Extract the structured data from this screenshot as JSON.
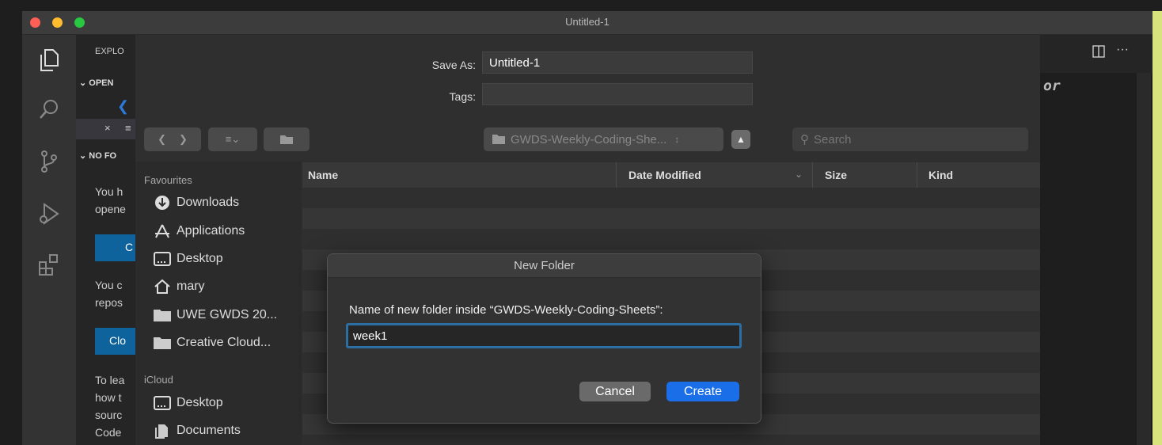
{
  "window": {
    "title": "Untitled-1",
    "traffic_lights": {
      "close": "#fe5f57",
      "minimize": "#febc2e",
      "zoom": "#28c840"
    }
  },
  "activity_bar": [
    "files-icon",
    "search-icon",
    "source-control-icon",
    "run-debug-icon",
    "extensions-icon"
  ],
  "sidebar": {
    "header": "EXPLO",
    "open_editors": "OPEN",
    "tab_close": "×",
    "tab_label": "≡",
    "no_folder": "NO FO",
    "text1": [
      "You h",
      "opene"
    ],
    "button1": "C",
    "text2": [
      "You c",
      "repos"
    ],
    "button2": "Clo",
    "text3": [
      "To lea",
      "how t",
      "sourc",
      "Code"
    ]
  },
  "editor": {
    "ghost_text": "or",
    "split_icon": "split-editor-icon",
    "more": "···"
  },
  "save_panel": {
    "save_as_label": "Save As:",
    "save_as_value": "Untitled-1",
    "tags_label": "Tags:",
    "tags_value": "",
    "location": "GWDS-Weekly-Coding-She...",
    "search_placeholder": "Search",
    "favourites_header": "Favourites",
    "favourites": [
      {
        "label": "Downloads",
        "icon": "downloads-icon"
      },
      {
        "label": "Applications",
        "icon": "applications-icon"
      },
      {
        "label": "Desktop",
        "icon": "desktop-icon"
      },
      {
        "label": "mary",
        "icon": "home-icon"
      },
      {
        "label": "UWE GWDS 20...",
        "icon": "folder-icon"
      },
      {
        "label": "Creative Cloud...",
        "icon": "folder-icon"
      }
    ],
    "icloud_header": "iCloud",
    "icloud": [
      {
        "label": "Desktop",
        "icon": "desktop-icon"
      },
      {
        "label": "Documents",
        "icon": "documents-icon"
      }
    ],
    "columns": {
      "name": "Name",
      "date": "Date Modified",
      "size": "Size",
      "kind": "Kind"
    }
  },
  "new_folder_dialog": {
    "title": "New Folder",
    "prompt": "Name of new folder inside “GWDS-Weekly-Coding-Sheets”:",
    "value": "week1",
    "cancel": "Cancel",
    "create": "Create"
  }
}
